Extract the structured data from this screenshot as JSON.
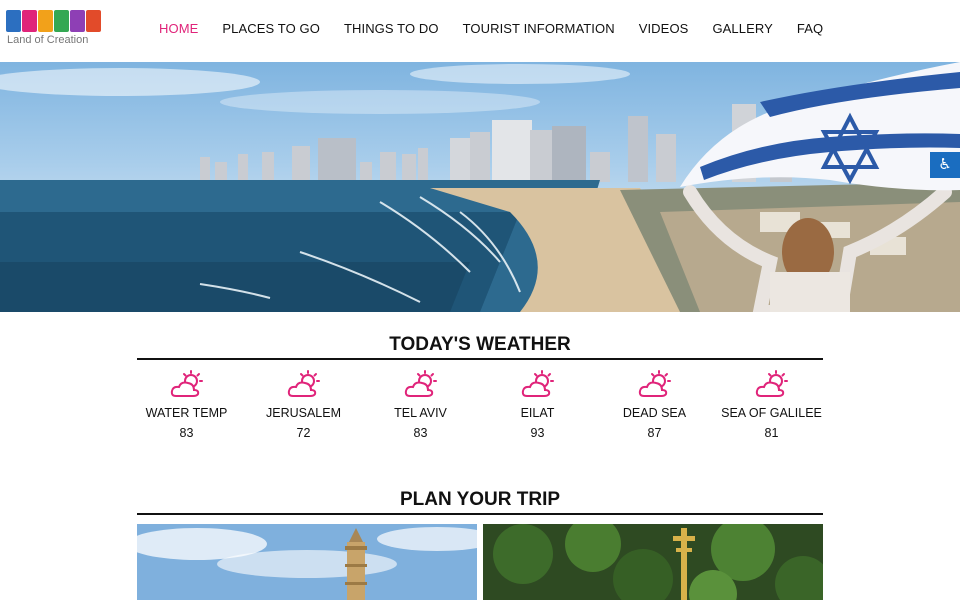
{
  "brand": {
    "logo_word": "ISRAEL",
    "tagline": "Land of Creation",
    "logo_colors": [
      "#2c6fc0",
      "#e0247a",
      "#f2a11a",
      "#34a853",
      "#8e3fb5",
      "#e24b2a"
    ]
  },
  "nav": {
    "items": [
      {
        "label": "HOME",
        "active": true
      },
      {
        "label": "PLACES TO GO",
        "active": false
      },
      {
        "label": "THINGS TO DO",
        "active": false
      },
      {
        "label": "TOURIST INFORMATION",
        "active": false
      },
      {
        "label": "VIDEOS",
        "active": false
      },
      {
        "label": "GALLERY",
        "active": false
      },
      {
        "label": "FAQ",
        "active": false
      }
    ],
    "active_color": "#e0247a"
  },
  "accessibility": {
    "icon": "accessibility-icon"
  },
  "weather": {
    "title": "TODAY'S WEATHER",
    "icon": "partly-cloudy-icon",
    "icon_color": "#e0247a",
    "items": [
      {
        "name": "WATER TEMP",
        "value": "83"
      },
      {
        "name": "JERUSALEM",
        "value": "72"
      },
      {
        "name": "TEL AVIV",
        "value": "83"
      },
      {
        "name": "EILAT",
        "value": "93"
      },
      {
        "name": "DEAD SEA",
        "value": "87"
      },
      {
        "name": "SEA OF GALILEE",
        "value": "81"
      }
    ]
  },
  "plan": {
    "title": "PLAN YOUR TRIP"
  }
}
